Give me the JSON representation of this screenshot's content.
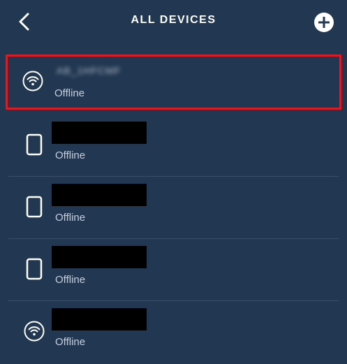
{
  "header": {
    "title": "ALL DEVICES",
    "back_icon": "chevron-left-icon",
    "add_icon": "plus-circle-icon"
  },
  "colors": {
    "background": "#223852",
    "selection_border": "#e01a22",
    "divider": "#3a4f68",
    "redaction": "#000000"
  },
  "devices": [
    {
      "icon": "wifi-icon",
      "name": "AB_1HFCMF",
      "status": "Offline",
      "selected": true,
      "name_redacted": "blurred"
    },
    {
      "icon": "tablet-icon",
      "name": "",
      "status": "Offline",
      "selected": false,
      "name_redacted": "black-box"
    },
    {
      "icon": "tablet-icon",
      "name": "",
      "status": "Offline",
      "selected": false,
      "name_redacted": "black-box"
    },
    {
      "icon": "tablet-icon",
      "name": "",
      "status": "Offline",
      "selected": false,
      "name_redacted": "black-box"
    },
    {
      "icon": "wifi-icon",
      "name": "",
      "status": "Offline",
      "selected": false,
      "name_redacted": "black-box"
    }
  ]
}
